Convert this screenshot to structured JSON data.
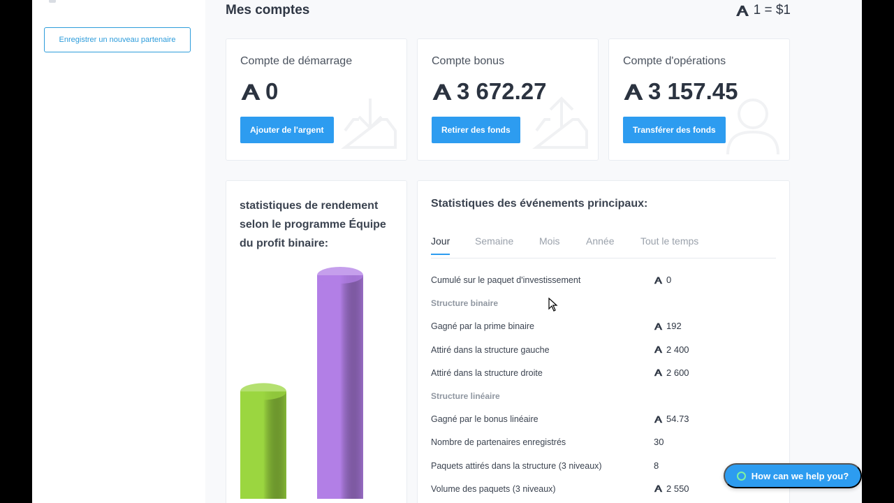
{
  "sidebar": {
    "register_label": "Enregistrer un nouveau partenaire"
  },
  "header": {
    "title": "Mes comptes",
    "rate": "1 = $1",
    "currency_icon": "aion-currency-icon"
  },
  "accounts": [
    {
      "title": "Compte de démarrage",
      "amount": "0",
      "button": "Ajouter de l'argent"
    },
    {
      "title": "Compte bonus",
      "amount": "3 672.27",
      "button": "Retirer des fonds"
    },
    {
      "title": "Compte d'opérations",
      "amount": "3 157.45",
      "button": "Transférer des fonds"
    }
  ],
  "performance": {
    "title": "statistiques de rendement selon le programme Équipe du profit binaire:",
    "bars": [
      {
        "value": 48,
        "color": "#9bd640"
      },
      {
        "value": 100,
        "color": "#b27fe6"
      }
    ]
  },
  "stats": {
    "title": "Statistiques des événements principaux:",
    "tabs": [
      "Jour",
      "Semaine",
      "Mois",
      "Année",
      "Tout le temps"
    ],
    "active_tab": "Jour",
    "rows": [
      {
        "label": "Cumulé sur le paquet d'investissement",
        "value": "0",
        "currency": true
      },
      {
        "label": "Structure binaire",
        "section": true
      },
      {
        "label": "Gagné par la prime binaire",
        "value": "192",
        "currency": true
      },
      {
        "label": "Attiré dans la structure gauche",
        "value": "2 400",
        "currency": true
      },
      {
        "label": "Attiré dans la structure droite",
        "value": "2 600",
        "currency": true
      },
      {
        "label": "Structure linéaire",
        "section": true
      },
      {
        "label": "Gagné par le bonus linéaire",
        "value": "54.73",
        "currency": true
      },
      {
        "label": "Nombre de partenaires enregistrés",
        "value": "30",
        "currency": false
      },
      {
        "label": "Paquets attirés dans la structure (3 niveaux)",
        "value": "8",
        "currency": false
      },
      {
        "label": "Volume des paquets (3 niveaux)",
        "value": "2 550",
        "currency": true
      }
    ]
  },
  "help": {
    "label": "How can we help you?"
  },
  "colors": {
    "accent": "#2d9cf0",
    "bar_green": "#9bd640",
    "bar_purple": "#b27fe6"
  }
}
